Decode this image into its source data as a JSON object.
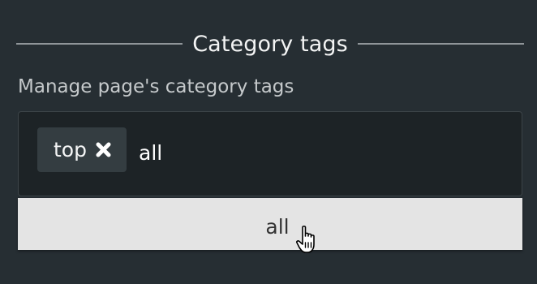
{
  "section": {
    "legend": "Category tags",
    "description": "Manage page's category tags"
  },
  "tag_input": {
    "tags": [
      {
        "label": "top",
        "remove_icon": "close-x-icon"
      }
    ],
    "current_value": "all"
  },
  "autocomplete": {
    "items": [
      {
        "label": "all"
      }
    ]
  },
  "cursor": {
    "icon": "hand-pointer-icon"
  },
  "colors": {
    "background": "#262e33",
    "input_background": "#1d2326",
    "chip_background": "#343d41",
    "dropdown_background": "#e4e4e4"
  }
}
